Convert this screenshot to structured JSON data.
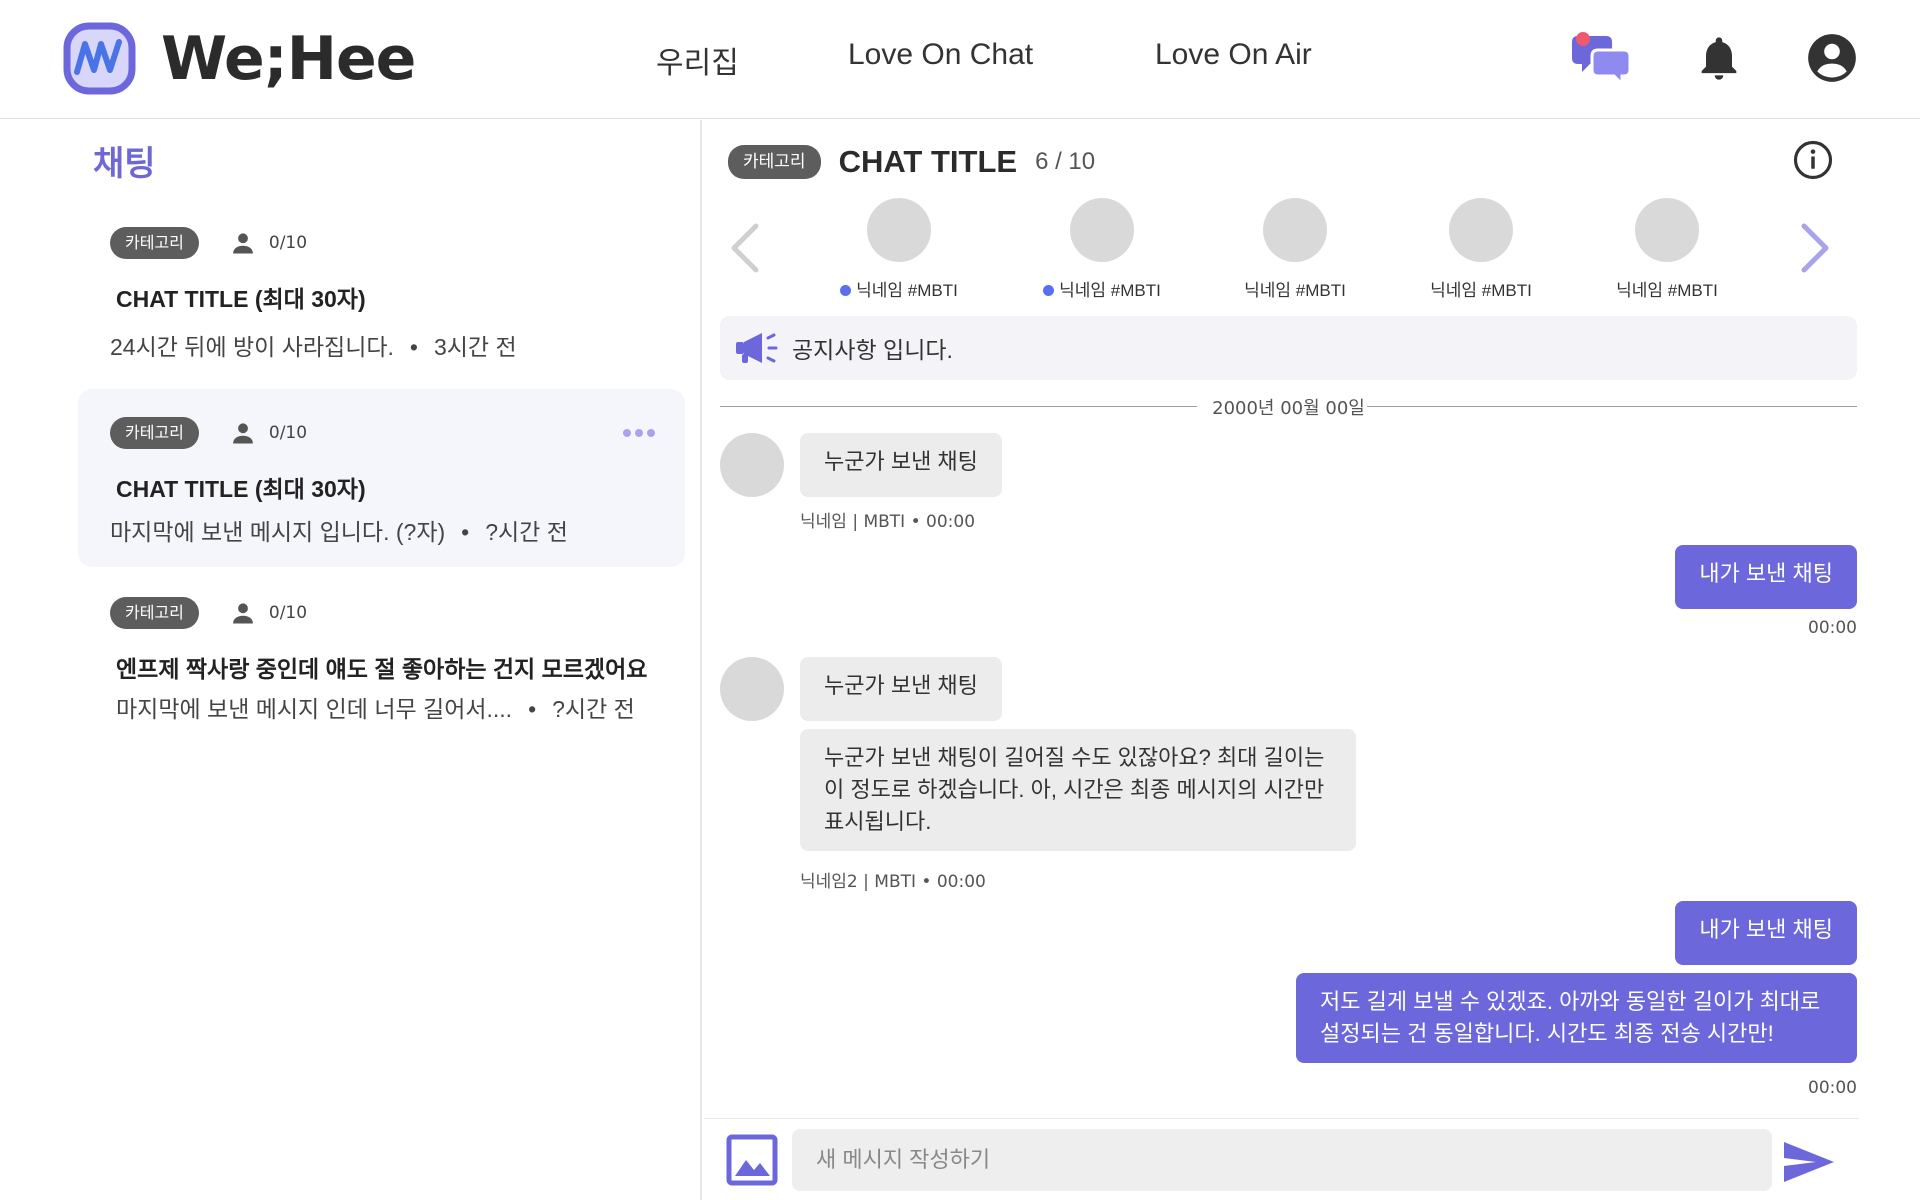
{
  "header": {
    "brand": "We;Hee",
    "nav": [
      "우리집",
      "Love On Chat",
      "Love On Air"
    ],
    "icons": [
      "chat-bubbles-icon",
      "bell-icon",
      "user-icon"
    ],
    "accent": "#6c67db"
  },
  "sidebar": {
    "title": "채팅",
    "rooms": [
      {
        "category": "카테고리",
        "count": "0/10",
        "title": "CHAT TITLE  (최대 30자)",
        "subtitle": "24시간 뒤에 방이 사라집니다.",
        "time": "3시간 전",
        "active": false
      },
      {
        "category": "카테고리",
        "count": "0/10",
        "title": "CHAT TITLE  (최대 30자)",
        "subtitle": "마지막에 보낸 메시지 입니다. (?자)",
        "time": "?시간 전",
        "active": true
      },
      {
        "category": "카테고리",
        "count": "0/10",
        "title": "엔프제 짝사랑 중인데 얘도 절 좋아하는 건지 모르겠어요",
        "subtitle": "마지막에 보낸 메시지 인데 너무 길어서....",
        "time": "?시간 전",
        "active": false
      }
    ]
  },
  "chat": {
    "category": "카테고리",
    "title": "CHAT TITLE",
    "count": "6 / 10",
    "members": [
      {
        "name": "닉네임 #MBTI",
        "online": true
      },
      {
        "name": "닉네임 #MBTI",
        "online": true
      },
      {
        "name": "닉네임 #MBTI",
        "online": false
      },
      {
        "name": "닉네임 #MBTI",
        "online": false
      },
      {
        "name": "닉네임 #MBTI",
        "online": false
      }
    ],
    "notice": "공지사항 입니다.",
    "date": "2000년 00월 00일",
    "messages": {
      "m1": {
        "text": "누군가 보낸 채팅",
        "meta": "닉네임 | MBTI  •  00:00"
      },
      "m2": {
        "text": "내가 보낸 채팅",
        "time": "00:00"
      },
      "m3a": {
        "text": "누군가 보낸 채팅"
      },
      "m3b": {
        "text": "누군가 보낸 채팅이 길어질 수도 있잖아요? 최대 길이는 이 정도로 하겠습니다. 아, 시간은 최종 메시지의 시간만 표시됩니다.",
        "meta": "닉네임2 | MBTI  •  00:00"
      },
      "m4a": {
        "text": "내가 보낸 채팅"
      },
      "m4b": {
        "text": "저도 길게 보낼 수 있겠죠. 아까와 동일한 길이가 최대로 설정되는 건 동일합니다. 시간도 최종 전송 시간만!",
        "time": "00:00"
      }
    },
    "composer": {
      "placeholder": "새 메시지 작성하기"
    }
  }
}
